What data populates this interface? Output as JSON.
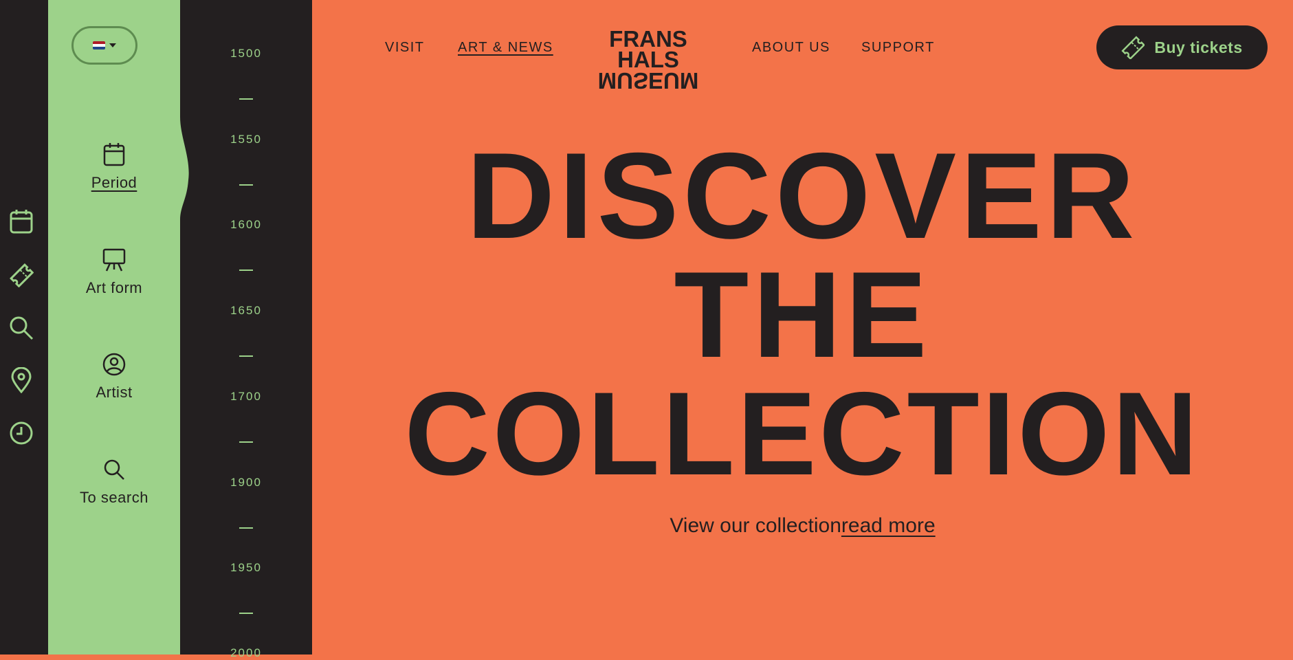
{
  "language": {
    "current": "NL",
    "flag_colors": [
      "#ae1c28",
      "#ffffff",
      "#21468b"
    ]
  },
  "filters": [
    {
      "label": "Period",
      "icon": "calendar-icon",
      "active": true
    },
    {
      "label": "Art form",
      "icon": "easel-icon",
      "active": false
    },
    {
      "label": "Artist",
      "icon": "user-circle-icon",
      "active": false
    },
    {
      "label": "To search",
      "icon": "search-icon",
      "active": false
    }
  ],
  "iconbar": [
    "calendar-icon",
    "ticket-icon",
    "search-icon",
    "location-pin-icon",
    "clock-icon"
  ],
  "timeline": {
    "years": [
      "1500",
      "1550",
      "1600",
      "1650",
      "1700",
      "1900",
      "1950",
      "2000"
    ]
  },
  "nav": {
    "items": [
      {
        "label": "VISIT",
        "active": false
      },
      {
        "label": "ART & NEWS",
        "active": true
      },
      {
        "label": "ABOUT US",
        "active": false
      },
      {
        "label": "SUPPORT",
        "active": false
      }
    ],
    "logo": {
      "line1": "FRANS HALS",
      "line2": "MUSEUM"
    },
    "tickets_label": "Buy tickets"
  },
  "hero": {
    "line1": "DISCOVER",
    "line2": "THE",
    "line3": "COLLECTION",
    "sub_text": "View our collection",
    "sub_link": "read more"
  },
  "colors": {
    "orange": "#f37349",
    "green": "#9dd28a",
    "dark": "#231f20"
  }
}
